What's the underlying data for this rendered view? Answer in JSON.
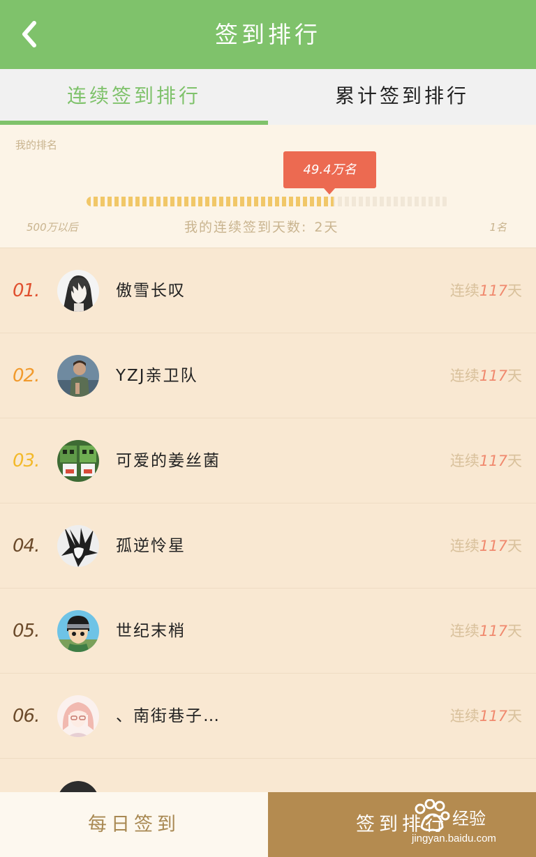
{
  "header": {
    "title": "签到排行"
  },
  "tabs": [
    {
      "label": "连续签到排行",
      "active": true
    },
    {
      "label": "累计签到排行",
      "active": false
    }
  ],
  "my_rank": {
    "label": "我的排名",
    "bubble": "49.4万名",
    "progress_fraction": 0.68,
    "scale_left": "500万以后",
    "days_label": "我的连续签到天数:",
    "days_value": "2天",
    "scale_right": "1名"
  },
  "ranking": [
    {
      "rank": "01.",
      "rank_color": "#e0502f",
      "name": "傲雪长叹",
      "streak_prefix": "连续",
      "streak_num": "117",
      "streak_suffix": "天",
      "avatar": "anime-sketch"
    },
    {
      "rank": "02.",
      "rank_color": "#f19a2d",
      "name": "YZJ亲卫队",
      "streak_prefix": "连续",
      "streak_num": "117",
      "streak_suffix": "天",
      "avatar": "man-photo"
    },
    {
      "rank": "03.",
      "rank_color": "#f3b929",
      "name": "可爱的姜丝菌",
      "streak_prefix": "连续",
      "streak_num": "117",
      "streak_suffix": "天",
      "avatar": "pixel-creepers"
    },
    {
      "rank": "04.",
      "rank_color": "#6b4a2a",
      "name": "孤逆怜星",
      "streak_prefix": "连续",
      "streak_num": "117",
      "streak_suffix": "天",
      "avatar": "anime-sketch-2"
    },
    {
      "rank": "05.",
      "rank_color": "#6b4a2a",
      "name": "世纪末梢",
      "streak_prefix": "连续",
      "streak_num": "117",
      "streak_suffix": "天",
      "avatar": "anime-ninja"
    },
    {
      "rank": "06.",
      "rank_color": "#6b4a2a",
      "name": "、南街巷子…",
      "streak_prefix": "连续",
      "streak_num": "117",
      "streak_suffix": "天",
      "avatar": "anime-girl"
    }
  ],
  "bottom": {
    "left_label": "每日签到",
    "right_label": "签到排行"
  },
  "watermark": {
    "brand": "经验",
    "url": "jingyan.baidu.com"
  },
  "colors": {
    "header_green": "#7fc26b",
    "bubble_red": "#ec6a51",
    "bottom_brown": "#b48b50",
    "list_bg": "#f9e8d2"
  }
}
